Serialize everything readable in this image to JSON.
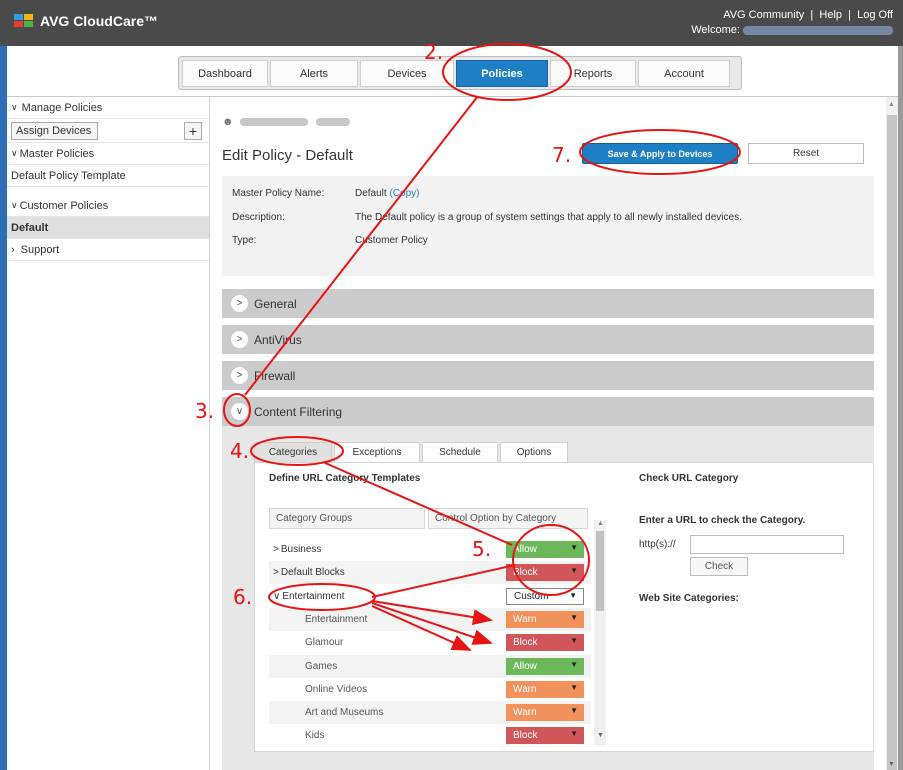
{
  "header": {
    "app_name": "AVG CloudCare™",
    "links": [
      "AVG Community",
      "Help",
      "Log Off"
    ],
    "welcome_label": "Welcome:"
  },
  "nav": {
    "tabs": [
      "Dashboard",
      "Alerts",
      "Devices",
      "Policies",
      "Reports",
      "Account"
    ],
    "active": "Policies"
  },
  "sidebar": {
    "manage_policies": "Manage Policies",
    "assign_devices": "Assign Devices",
    "add_symbol": "+",
    "master_policies": "Master Policies",
    "default_template": "Default Policy Template",
    "customer_policies": "Customer Policies",
    "default": "Default",
    "support": "Support"
  },
  "policy": {
    "title": "Edit Policy - Default",
    "save_button": "Save & Apply to Devices",
    "reset_button": "Reset",
    "master_label": "Master Policy Name:",
    "master_value": "Default",
    "copy_link": "(Copy)",
    "description_label": "Description:",
    "description_value": "The Default policy is a group of system settings that apply to all newly installed devices.",
    "type_label": "Type:",
    "type_value": "Customer Policy"
  },
  "sections": [
    "General",
    "AntiVirus",
    "Firewall",
    "Content Filtering"
  ],
  "content_filtering": {
    "tabs": [
      "Categories",
      "Exceptions",
      "Schedule",
      "Options"
    ],
    "active_tab": "Categories",
    "define_heading": "Define URL Category Templates",
    "col_groups": "Category Groups",
    "col_control": "Control Option by Category",
    "rows": [
      {
        "name": "Business",
        "option": "Allow",
        "type": "group"
      },
      {
        "name": "Default Blocks",
        "option": "Block",
        "type": "group"
      },
      {
        "name": "Entertainment",
        "option": "Custom",
        "type": "group-open"
      },
      {
        "name": "Entertainment",
        "option": "Warn",
        "type": "sub"
      },
      {
        "name": "Glamour",
        "option": "Block",
        "type": "sub"
      },
      {
        "name": "Games",
        "option": "Allow",
        "type": "sub"
      },
      {
        "name": "Online Videos",
        "option": "Warn",
        "type": "sub"
      },
      {
        "name": "Art and Museums",
        "option": "Warn",
        "type": "sub"
      },
      {
        "name": "Kids",
        "option": "Block",
        "type": "sub"
      }
    ],
    "option_colors": {
      "Allow": "#6cb85a",
      "Block": "#d0565a",
      "Warn": "#f1915c",
      "Custom": "#ffffff"
    },
    "check_heading": "Check URL Category",
    "check_prompt": "Enter a URL to check the Category.",
    "http_prefix": "http(s)://",
    "check_button": "Check",
    "web_site_categories": "Web Site Categories:"
  },
  "annotations": {
    "step2": "2.",
    "step3": "3.",
    "step4": "4.",
    "step5": "5.",
    "step6": "6.",
    "step7": "7.",
    "color": "#e61414"
  }
}
